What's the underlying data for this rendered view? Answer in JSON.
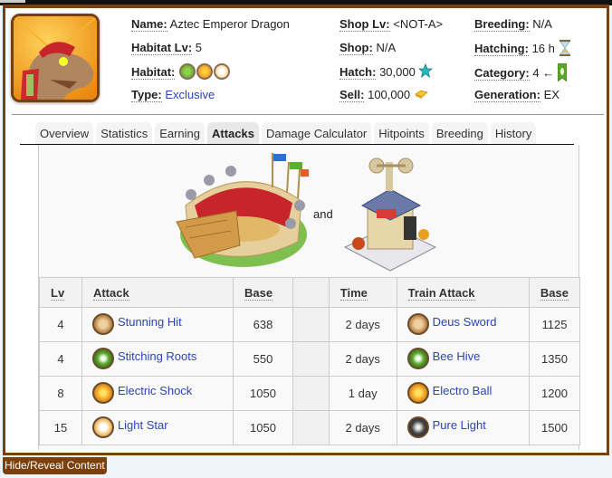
{
  "dragon": {
    "name_label": "Name:",
    "name": "Aztec Emperor Dragon",
    "habitat_lv_label": "Habitat Lv:",
    "habitat_lv": "5",
    "habitat_label": "Habitat:",
    "habitat_elements": [
      "nature",
      "electric",
      "light"
    ],
    "type_label": "Type:",
    "type": "Exclusive",
    "shop_lv_label": "Shop Lv:",
    "shop_lv": "<NOT-A>",
    "shop_label": "Shop:",
    "shop": "N/A",
    "hatch_label": "Hatch:",
    "hatch": "30,000",
    "hatch_icon": "star-icon",
    "sell_label": "Sell:",
    "sell": "100,000",
    "sell_icon": "gold-icon",
    "breeding_label": "Breeding:",
    "breeding": "N/A",
    "hatching_label": "Hatching:",
    "hatching": "16 h",
    "hatching_icon": "hourglass-icon",
    "category_label": "Category:",
    "category": "4 ←",
    "category_icon": "nature-banner-icon",
    "generation_label": "Generation:",
    "generation": "EX"
  },
  "tabs": [
    {
      "label": "Overview",
      "active": false
    },
    {
      "label": "Statistics",
      "active": false
    },
    {
      "label": "Earning",
      "active": false
    },
    {
      "label": "Attacks",
      "active": true
    },
    {
      "label": "Damage Calculator",
      "active": false
    },
    {
      "label": "Hitpoints",
      "active": false
    },
    {
      "label": "Breeding",
      "active": false
    },
    {
      "label": "History",
      "active": false
    }
  ],
  "buildings": {
    "left": "arena-building",
    "connector": "and",
    "right": "training-center-building"
  },
  "attacks_table": {
    "headers": {
      "lv": "Lv",
      "attack": "Attack",
      "base": "Base",
      "time": "Time",
      "train_attack": "Train Attack",
      "train_base": "Base"
    },
    "rows": [
      {
        "lv": "4",
        "attack": "Stunning Hit",
        "attack_element": "physical",
        "base": "638",
        "time": "2 days",
        "train_attack": "Deus Sword",
        "train_element": "physical",
        "train_base": "1125"
      },
      {
        "lv": "4",
        "attack": "Stitching Roots",
        "attack_element": "nature",
        "base": "550",
        "time": "2 days",
        "train_attack": "Bee Hive",
        "train_element": "nature",
        "train_base": "1350"
      },
      {
        "lv": "8",
        "attack": "Electric Shock",
        "attack_element": "electric",
        "base": "1050",
        "time": "1 day",
        "train_attack": "Electro Ball",
        "train_element": "electric",
        "train_base": "1200"
      },
      {
        "lv": "15",
        "attack": "Light Star",
        "attack_element": "light",
        "base": "1050",
        "time": "2 days",
        "train_attack": "Pure Light",
        "train_element": "pure",
        "train_base": "1500"
      }
    ]
  },
  "hide_button": "Hide/Reveal Content",
  "colors": {
    "frame": "#7a3f0a",
    "link": "#2a45b8",
    "nature": "#5aa52a",
    "electric": "#e8951a",
    "light": "#f1d99a",
    "physical": "#c8a070",
    "pure": "#333333"
  }
}
